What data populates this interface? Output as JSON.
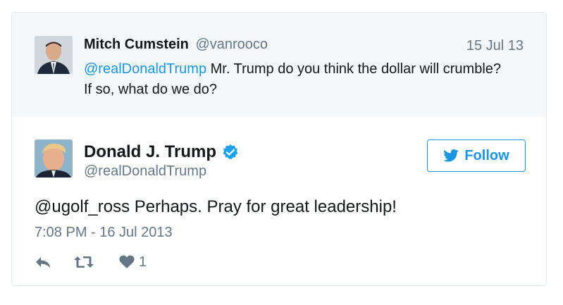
{
  "reply_tweet": {
    "author_name": "Mitch Cumstein",
    "author_handle": "@vanrooco",
    "date": "15 Jul 13",
    "mention": "@realDonaldTrump",
    "text": " Mr. Trump do you think the dollar will crumble? If so, what do we do?"
  },
  "main_tweet": {
    "author_name": "Donald J. Trump",
    "author_handle": "@realDonaldTrump",
    "verified": true,
    "follow_label": "Follow",
    "text": "@ugolf_ross Perhaps. Pray for great leadership!",
    "timestamp": "7:08 PM - 16 Jul 2013",
    "like_count": "1"
  },
  "colors": {
    "link": "#1b95e0",
    "muted": "#657786",
    "reply_bg": "#f5f8fa",
    "border": "#e1e8ed"
  },
  "icons": {
    "verified": "verified-badge-icon",
    "follow": "twitter-bird-icon",
    "reply": "reply-arrow-icon",
    "retweet": "retweet-icon",
    "like": "heart-icon"
  }
}
